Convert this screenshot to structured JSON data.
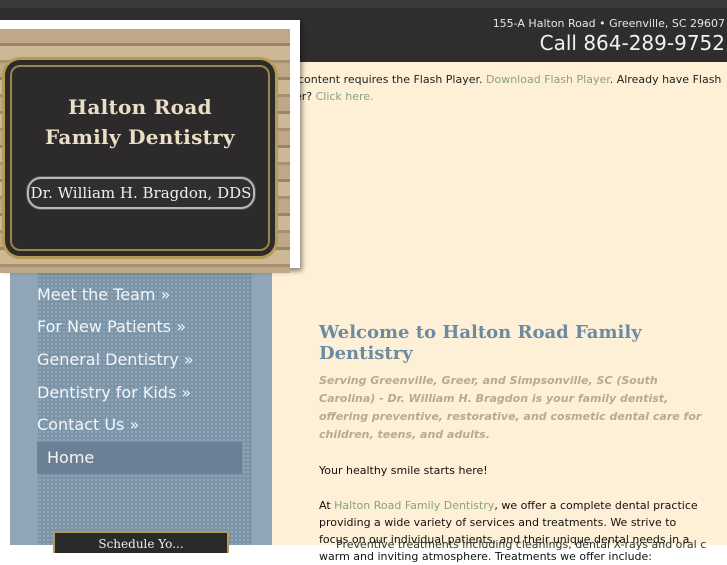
{
  "header": {
    "address": "155-A Halton Road • Greenville, SC 29607",
    "phone": "Call 864-289-9752"
  },
  "logo": {
    "title_line1": "Halton Road",
    "title_line2": "Family Dentistry",
    "doctor": "Dr. William H. Bragdon, DDS"
  },
  "flash_notice": {
    "text1": "This content requires the Flash Player.",
    "link": "Download Flash Player",
    "text2": ". Already have Flash Player?",
    "click_here": "Click here."
  },
  "nav": {
    "items": [
      {
        "label": "Meet the Team »"
      },
      {
        "label": "For New Patients »"
      },
      {
        "label": "General Dentistry »"
      },
      {
        "label": "Dentistry for Kids »"
      },
      {
        "label": "Contact Us »"
      },
      {
        "label": "Home"
      }
    ],
    "schedule_label": "Schedule Yo..."
  },
  "main": {
    "heading": "Welcome to Halton Road Family Dentistry",
    "intro": "Serving Greenville, Greer, and Simpsonville, SC (South Carolina) - Dr. William H. Bragdon is your family dentist, offering preventive, restorative, and cosmetic dental care for children, teens, and adults.",
    "tagline": "Your healthy smile starts here!",
    "para_prefix": "At ",
    "para_link": "Halton Road Family Dentistry",
    "para_rest": ", we offer a complete dental practice providing a wide variety of services and treatments. We strive to focus on our individual patients, and their unique dental needs in a warm and inviting atmosphere. Treatments we offer include:",
    "cut_line": "Preventive treatments including cleanings, dental X-rays and oral cancer"
  },
  "colors": {
    "header_bg": "#2e2e2e",
    "content_bg": "#fdf0d6",
    "nav_bg": "#7c94a8",
    "accent_link": "#8a9f86",
    "heading": "#6d8aa3",
    "gold": "#b69b55"
  }
}
